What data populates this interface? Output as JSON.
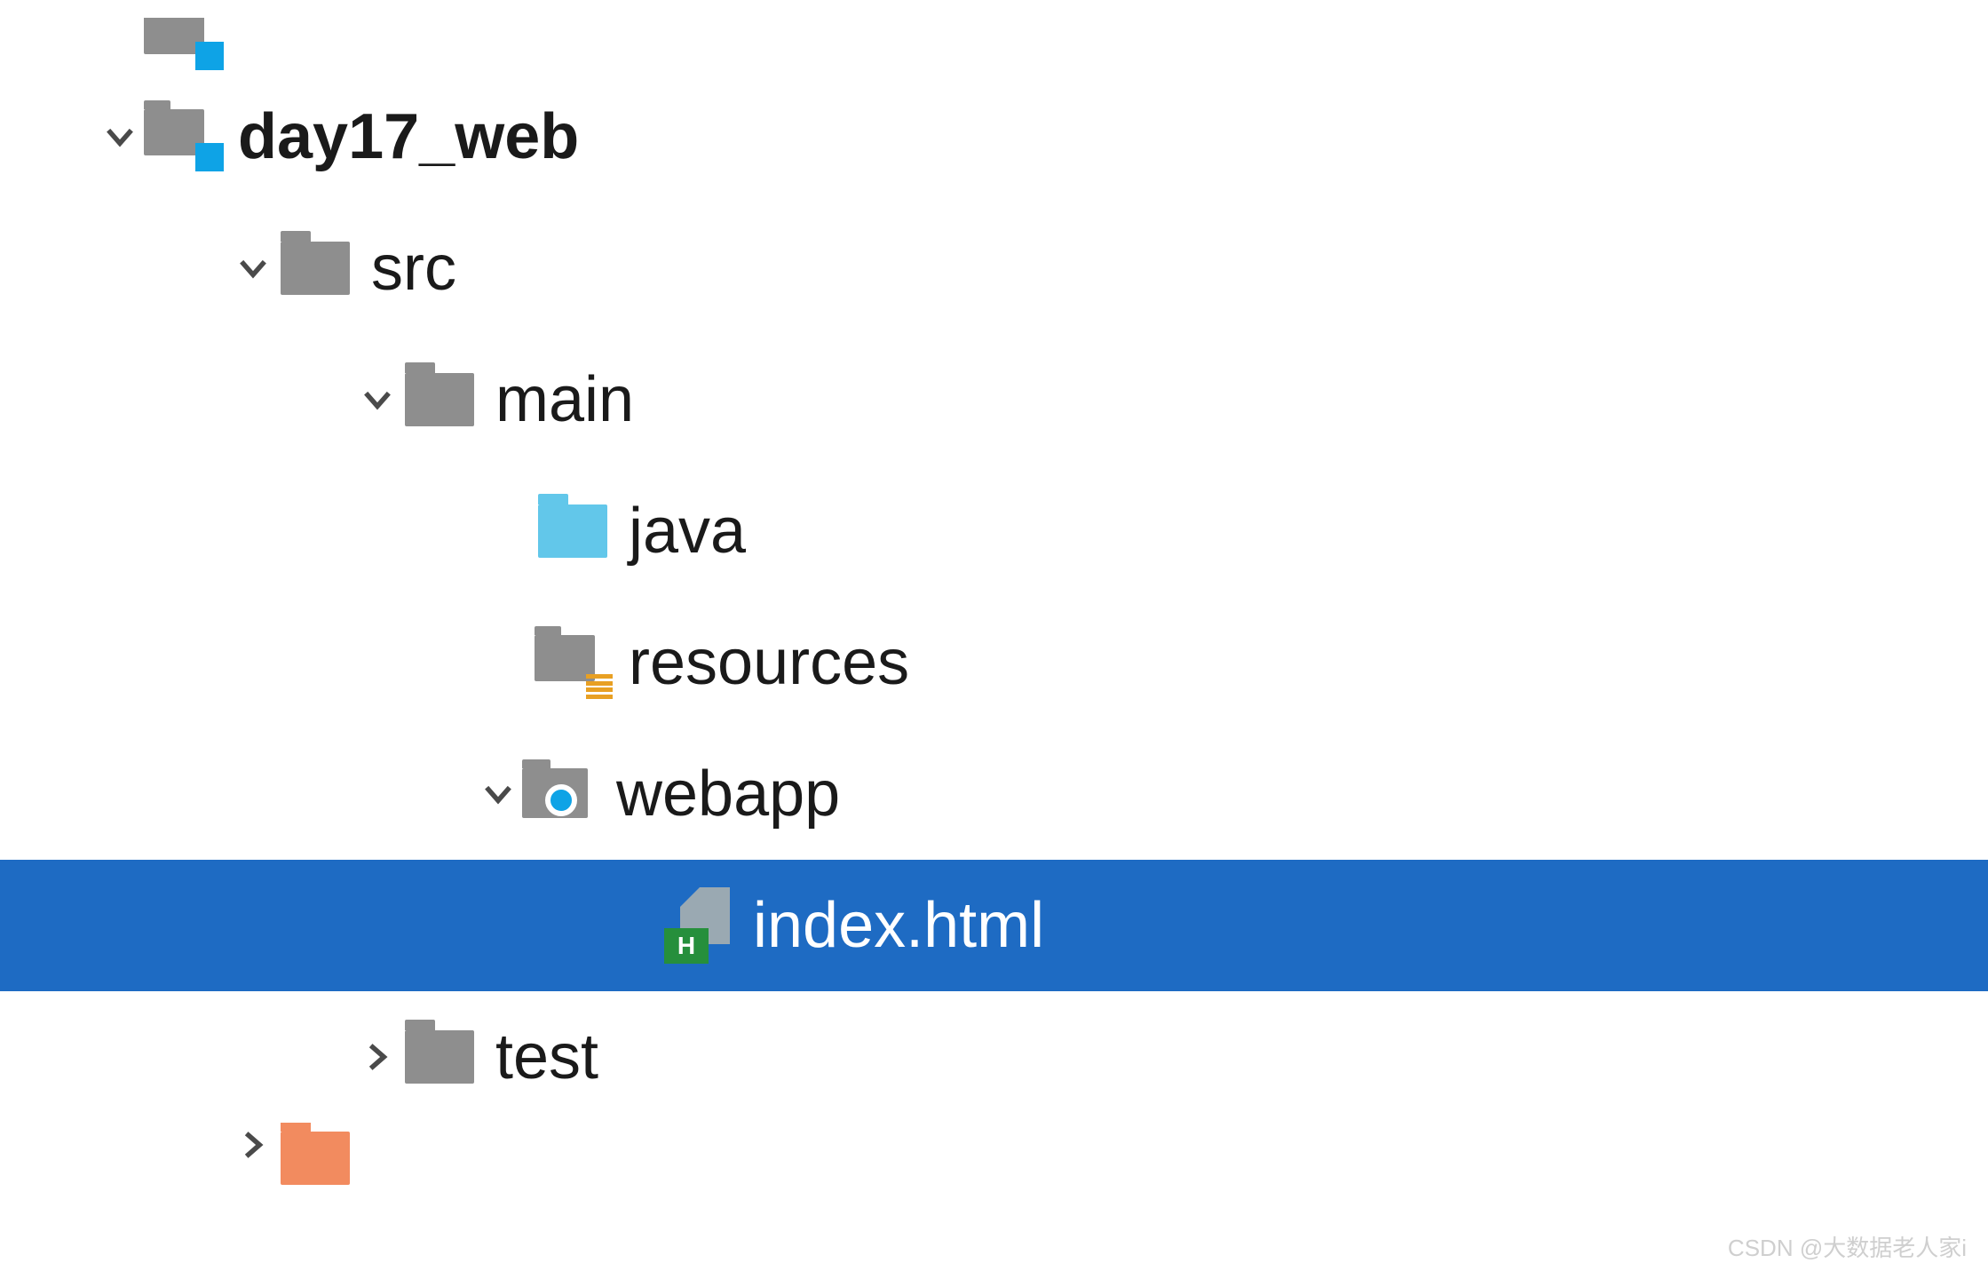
{
  "tree": {
    "partial_top": {
      "label": ""
    },
    "module": {
      "label": "day17_web"
    },
    "src": {
      "label": "src"
    },
    "main": {
      "label": "main"
    },
    "java": {
      "label": "java"
    },
    "resources": {
      "label": "resources"
    },
    "webapp": {
      "label": "webapp"
    },
    "index_html": {
      "label": "index.html",
      "badge": "H"
    },
    "test": {
      "label": "test"
    },
    "partial_bottom": {
      "label": ""
    }
  },
  "watermark": "CSDN @大数据老人家i"
}
